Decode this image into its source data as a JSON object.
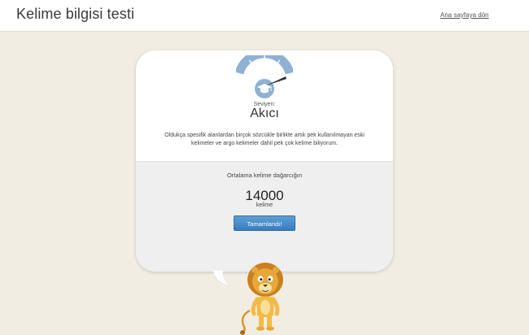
{
  "header": {
    "title": "Kelime bilgisi testi",
    "home_link": "Ana sayfaya dön"
  },
  "result": {
    "level_label": "Seviyen:",
    "level_value": "Akıcı",
    "description": "Oldukça spesifik alanlardan birçok sözcükle birlikte artık pek kullanılmayan eski kelimeler ve argo kelimeler dahil pek çok kelime biliyorum.",
    "gauge_level": 0.92
  },
  "stats": {
    "avg_label": "Ortalama kelime dağarcığın",
    "word_count": "14000",
    "word_unit": "kelime"
  },
  "actions": {
    "done_label": "Tamamlandı!"
  },
  "colors": {
    "gauge": "#8fb2d3",
    "needle": "#333333",
    "button": "#4a8cc9",
    "background": "#f2ede3"
  },
  "icons": {
    "gauge": "gauge-icon",
    "cap": "graduation-cap-icon",
    "mascot": "lion-mascot"
  }
}
